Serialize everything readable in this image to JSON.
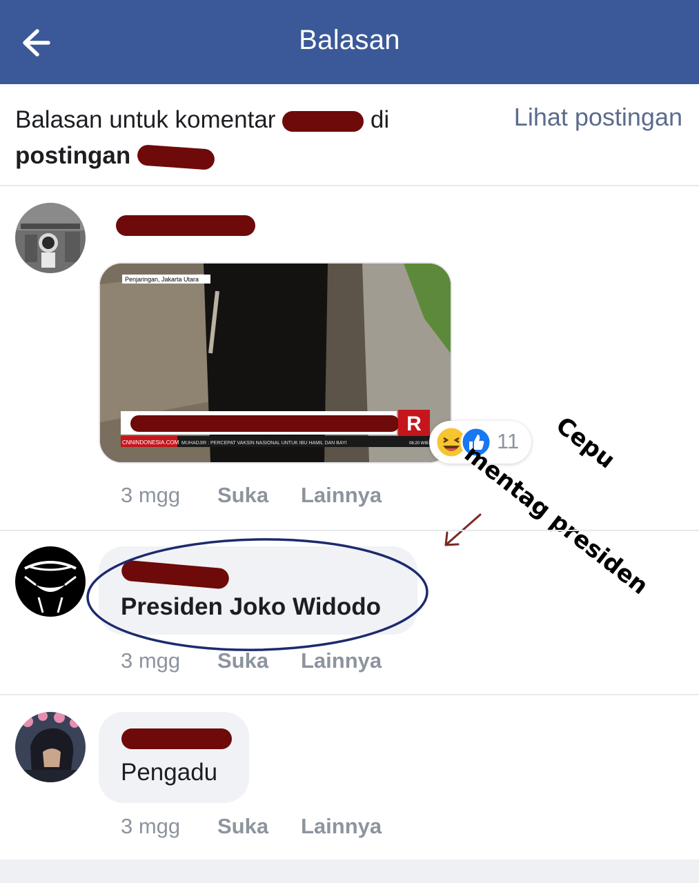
{
  "header": {
    "title": "Balasan",
    "back_icon": "arrow-left-icon"
  },
  "context": {
    "prefix": "Balasan untuk komentar",
    "middle": "di",
    "post_word": "postingan",
    "view_post_link": "Lihat postingan"
  },
  "colors": {
    "header_bg": "#3b5998",
    "link": "#5b6b8c",
    "meta_text": "#8d949e",
    "redaction": "#6e0a0a"
  },
  "media": {
    "location_caption": "Penjaringan, Jakarta Utara",
    "channel_logo": "R",
    "ticker_source": "CNNINDONESIA.COM",
    "ticker_text": "MUHADJIR : PERCEPAT VAKSIN NASIONAL UNTUK IBU HAMIL DAN BAYI",
    "ticker_time": "06:20 WIB"
  },
  "reactions": {
    "icons": [
      "haha-emoji-icon",
      "like-thumb-icon"
    ],
    "count": "11"
  },
  "comments": [
    {
      "text": "",
      "time": "3 mgg",
      "like_label": "Suka",
      "more_label": "Lainnya"
    },
    {
      "text": "Presiden Joko Widodo",
      "time": "3 mgg",
      "like_label": "Suka",
      "more_label": "Lainnya"
    },
    {
      "text": "Pengadu",
      "time": "3 mgg",
      "like_label": "Suka",
      "more_label": "Lainnya"
    }
  ],
  "annotation": {
    "line1": "Cepu",
    "line2": "mentag presiden"
  }
}
